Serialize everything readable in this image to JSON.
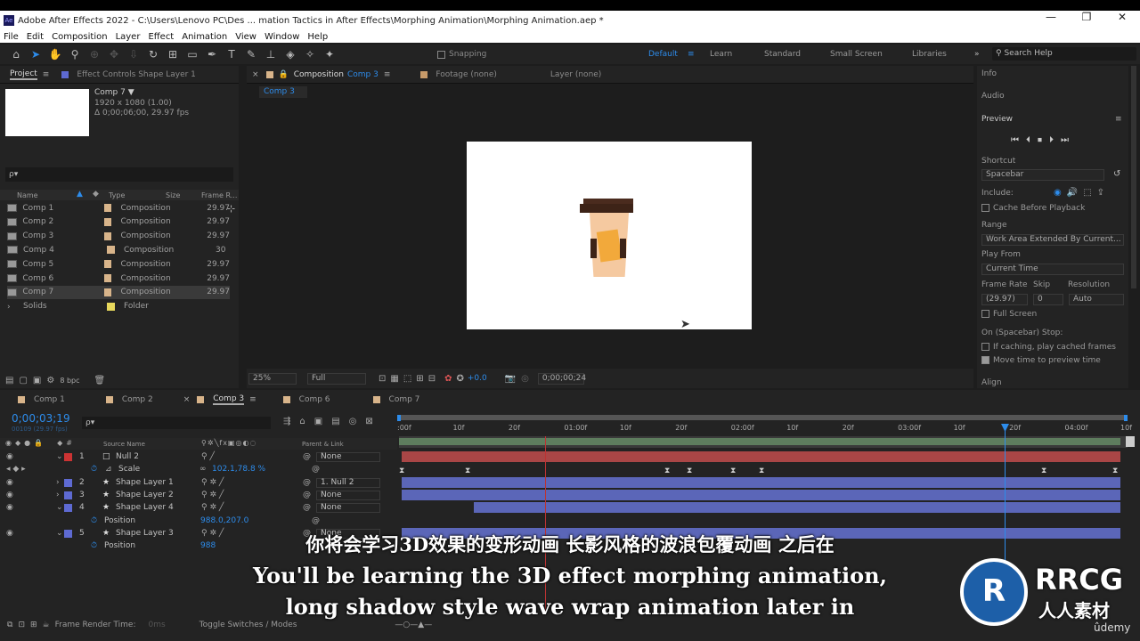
{
  "window": {
    "title": "Adobe After Effects 2022 - C:\\Users\\Lenovo PC\\Des ... mation Tactics in After Effects\\Morphing Animation\\Morphing Animation.aep *",
    "logo": "Ae"
  },
  "menu": [
    "File",
    "Edit",
    "Composition",
    "Layer",
    "Effect",
    "Animation",
    "View",
    "Window",
    "Help"
  ],
  "toolbar": {
    "snapping": "Snapping"
  },
  "workspaces": {
    "active": "Default",
    "items": [
      "Learn",
      "Standard",
      "Small Screen",
      "Libraries"
    ],
    "search": "Search Help"
  },
  "project": {
    "tab": "Project",
    "effect_tab": "Effect Controls Shape Layer 1",
    "comp_name": "Comp 7 ▼",
    "comp_size": "1920 x 1080 (1.00)",
    "comp_dur": "Δ 0;00;06;00, 29.97 fps",
    "search_placeholder": "ρ▾",
    "headers": {
      "name": "Name",
      "type": "Type",
      "size": "Size",
      "frame": "Frame R..."
    },
    "items": [
      {
        "name": "Comp 1",
        "type": "Composition",
        "fps": "29.97"
      },
      {
        "name": "Comp 2",
        "type": "Composition",
        "fps": "29.97"
      },
      {
        "name": "Comp 3",
        "type": "Composition",
        "fps": "29.97"
      },
      {
        "name": "Comp 4",
        "type": "Composition",
        "fps": "30"
      },
      {
        "name": "Comp 5",
        "type": "Composition",
        "fps": "29.97"
      },
      {
        "name": "Comp 6",
        "type": "Composition",
        "fps": "29.97"
      },
      {
        "name": "Comp 7",
        "type": "Composition",
        "fps": "29.97"
      },
      {
        "name": "Solids",
        "type": "Folder",
        "fps": ""
      }
    ],
    "bpc": "8 bpc"
  },
  "viewer": {
    "comp_tab": "Composition",
    "comp_tab_name": "Comp 3",
    "footage": "Footage (none)",
    "layer": "Layer (none)",
    "breadcrumb": "Comp 3",
    "zoom": "25%",
    "quality": "Full",
    "exposure": "+0.0",
    "timecode": "0;00;00;24"
  },
  "right": {
    "info": "Info",
    "audio": "Audio",
    "preview": "Preview",
    "shortcut_label": "Shortcut",
    "shortcut": "Spacebar",
    "include": "Include:",
    "cache": "Cache Before Playback",
    "range_label": "Range",
    "range": "Work Area Extended By Current...",
    "playfrom_label": "Play From",
    "playfrom": "Current Time",
    "framerate_label": "Frame Rate",
    "skip_label": "Skip",
    "res_label": "Resolution",
    "framerate": "(29.97)",
    "skip": "0",
    "resolution": "Auto",
    "fullscreen": "Full Screen",
    "stop_label": "On (Spacebar) Stop:",
    "if_caching": "If caching, play cached frames",
    "move_time": "Move time to preview time",
    "align": "Align"
  },
  "timeline": {
    "tabs": [
      "Comp 1",
      "Comp 2",
      "Comp 3",
      "Comp 6",
      "Comp 7"
    ],
    "active_tab": "Comp 3",
    "timecode": "0;00;03;19",
    "frames": "00109 (29.97 fps)",
    "search": "ρ▾",
    "col_source": "Source Name",
    "col_parent": "Parent & Link",
    "ruler": [
      ":00f",
      "10f",
      "20f",
      "01:00f",
      "10f",
      "20f",
      "02:00f",
      "10f",
      "20f",
      "03:00f",
      "10f",
      "20f",
      "04:00f",
      "10f"
    ],
    "layers": [
      {
        "num": "1",
        "name": "Null 2",
        "parent": "None"
      },
      {
        "num": "",
        "name": "Scale",
        "parent": "",
        "value": "102.1,78.8 %"
      },
      {
        "num": "2",
        "name": "Shape Layer 1",
        "parent": "1. Null 2"
      },
      {
        "num": "3",
        "name": "Shape Layer 2",
        "parent": "None"
      },
      {
        "num": "4",
        "name": "Shape Layer 4",
        "parent": "None"
      },
      {
        "num": "",
        "name": "Position",
        "parent": "",
        "value": "988.0,207.0"
      },
      {
        "num": "5",
        "name": "Shape Layer 3",
        "parent": "None"
      },
      {
        "num": "",
        "name": "Position",
        "parent": "",
        "value": "988"
      }
    ],
    "footer_left": "Frame Render Time:",
    "render_time": "0ms",
    "toggle": "Toggle Switches / Modes"
  },
  "subtitles": {
    "zh": "你将会学习3D效果的变形动画 长影风格的波浪包覆动画 之后在",
    "en1": "You'll be learning the 3D effect morphing animation,",
    "en2": "long shadow style wave wrap animation later in"
  },
  "watermark": {
    "brand": "RRCG",
    "cn": "人人素材",
    "udemy": "ûdemy"
  },
  "colors": {
    "accent": "#2d8ceb",
    "bar": "#5b66b8",
    "null_bar": "#a94646",
    "cup_lid": "#4a2b1e",
    "cup_body": "#f5c9a0",
    "cup_sleeve": "#f2a93b"
  }
}
